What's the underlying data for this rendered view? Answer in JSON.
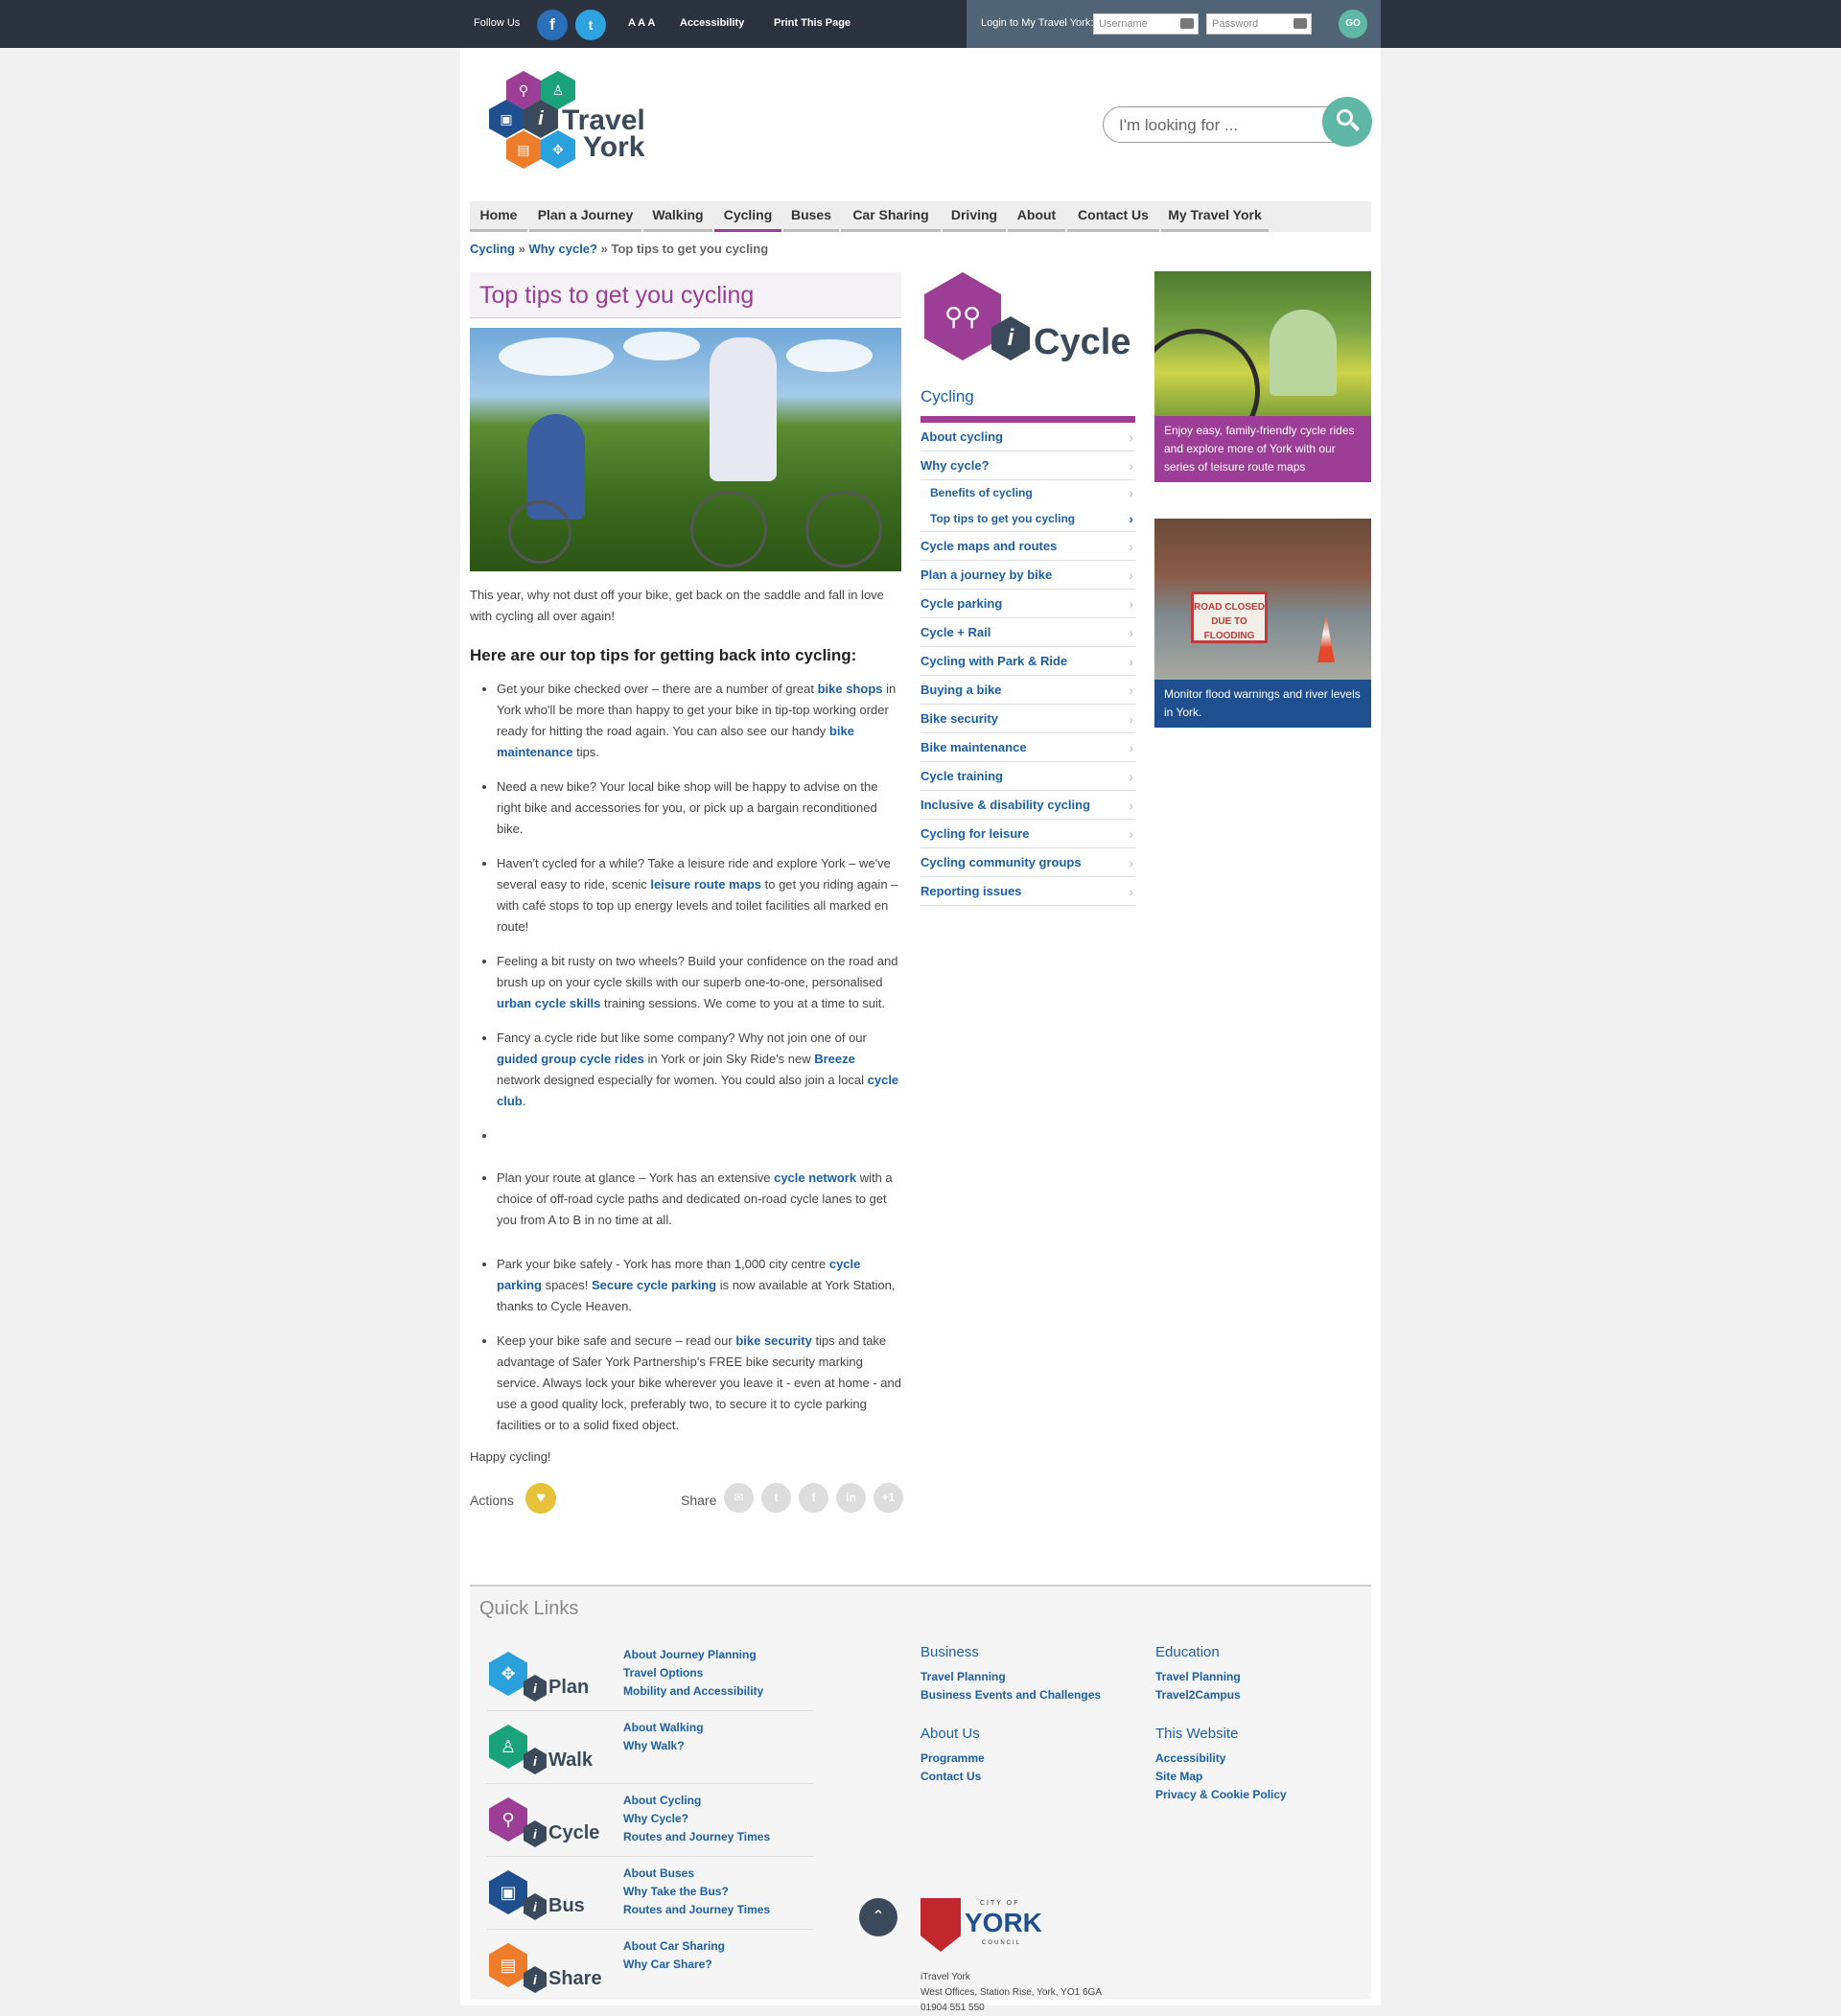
{
  "topbar": {
    "follow_label": "Follow Us",
    "facebook_glyph": "f",
    "twitter_glyph": "t",
    "text_size_label": "A A A",
    "accessibility_label": "Accessibility",
    "print_label": "Print This Page",
    "login_label": "Login to My Travel York:",
    "username_placeholder": "Username",
    "password_placeholder": "Password",
    "go_label": "GO"
  },
  "header": {
    "logo_line1": "Travel",
    "logo_line2": "York",
    "search_placeholder": "I'm looking for ..."
  },
  "nav": [
    {
      "label": "Home"
    },
    {
      "label": "Plan a Journey"
    },
    {
      "label": "Walking"
    },
    {
      "label": "Cycling"
    },
    {
      "label": "Buses"
    },
    {
      "label": "Car Sharing"
    },
    {
      "label": "Driving"
    },
    {
      "label": "About"
    },
    {
      "label": "Contact Us"
    },
    {
      "label": "My Travel York"
    }
  ],
  "breadcrumb": {
    "item1": "Cycling",
    "sep1": "»",
    "item2": "Why cycle?",
    "sep2": "»",
    "current": "Top tips to get you cycling"
  },
  "main": {
    "title": "Top tips to get you cycling",
    "intro": "This year, why not dust off your bike, get back on the saddle and fall in love with cycling all over again!",
    "subheading": "Here are our top tips for getting back into cycling:",
    "tips": [
      {
        "a": "Get your bike checked over – there are a number of great ",
        "l1": "bike shops",
        "b": " in York who'll be more than happy to get your bike in tip-top working order ready for hitting the road again. You can also see our handy ",
        "l2": "bike maintenance",
        "c": " tips."
      },
      {
        "a": "Need a new bike? Your local bike shop will be happy to advise on the right bike and accessories for you, or pick up a bargain reconditioned bike."
      },
      {
        "a": "Haven't cycled for a while? Take a leisure ride and explore York – we've several easy to ride, scenic ",
        "l1": "leisure route maps",
        "b": " to get you riding again – with café stops to top up energy levels and toilet facilities all marked en route!"
      },
      {
        "a": "Feeling a bit rusty on two wheels? Build your confidence on the road and brush up on your cycle skills with our superb one-to-one, personalised ",
        "l1": "urban cycle skills",
        "b": " training sessions. We come to you at a time to suit."
      },
      {
        "a": "Fancy a cycle ride but like some company? Why not join one of our ",
        "l1": "guided group cycle rides",
        "b": " in York or join Sky Ride's new ",
        "l2": "Breeze",
        "c": " network designed especially for women. You could also join a local ",
        "l3": "cycle club",
        "d": "."
      },
      {
        "a": "Plan your route at glance – York has an extensive ",
        "l1": "cycle network",
        "b": " with a choice of off-road cycle paths and dedicated on-road cycle lanes to get you from A to B in no time at all."
      },
      {
        "a": "Park your bike safely - York has more than 1,000 city centre ",
        "l1": "cycle parking",
        "b": " spaces! ",
        "l2": "Secure cycle parking",
        "c": " is now available at York Station, thanks to Cycle Heaven."
      },
      {
        "a": "Keep your bike safe and secure – read our ",
        "l1": "bike security",
        "b": " tips and take advantage of Safer York Partnership's FREE bike security marking service. Always lock your bike wherever you leave it - even at home - and use a good quality lock, preferably two, to secure it to cycle parking facilities or to a solid fixed object."
      }
    ],
    "outro": "Happy cycling!",
    "actions_label": "Actions",
    "share_label": "Share",
    "share_icons": [
      "email-icon",
      "twitter-icon",
      "facebook-icon",
      "linkedin-icon",
      "google-plus-icon"
    ],
    "share_glyphs": [
      "✉",
      "t",
      "f",
      "in",
      "+1"
    ]
  },
  "sidebar": {
    "brand_text": "Cycle",
    "title": "Cycling",
    "items": [
      {
        "label": "About cycling"
      },
      {
        "label": "Why cycle?"
      },
      {
        "label": "Benefits of cycling"
      },
      {
        "label": "Top tips to get you cycling"
      },
      {
        "label": "Cycle maps and routes"
      },
      {
        "label": "Plan a journey by bike"
      },
      {
        "label": "Cycle parking"
      },
      {
        "label": "Cycle + Rail"
      },
      {
        "label": "Cycling with Park & Ride"
      },
      {
        "label": "Buying a bike"
      },
      {
        "label": "Bike security"
      },
      {
        "label": "Bike maintenance"
      },
      {
        "label": "Cycle training"
      },
      {
        "label": "Inclusive & disability cycling"
      },
      {
        "label": "Cycling for leisure"
      },
      {
        "label": "Cycling community groups"
      },
      {
        "label": "Reporting issues"
      }
    ]
  },
  "promos": [
    {
      "caption": "Enjoy easy, family-friendly cycle rides and explore more of York with our series of leisure route maps",
      "color": "#9c3d96"
    },
    {
      "caption": "Monitor flood warnings and river levels in York.",
      "color": "#1f4f8f",
      "sign": "ROAD CLOSED DUE TO FLOODING"
    }
  ],
  "footer": {
    "quick_links_title": "Quick Links",
    "quick_rows": [
      {
        "brand": "Plan",
        "color": "#2aa0dc",
        "links": [
          "About Journey Planning",
          "Travel Options",
          "Mobility and Accessibility"
        ]
      },
      {
        "brand": "Walk",
        "color": "#1aa37a",
        "links": [
          "About Walking",
          "Why Walk?"
        ]
      },
      {
        "brand": "Cycle",
        "color": "#9c3d96",
        "links": [
          "About Cycling",
          "Why Cycle?",
          "Routes and Journey Times"
        ]
      },
      {
        "brand": "Bus",
        "color": "#1f4f8f",
        "links": [
          "About Buses",
          "Why Take the Bus?",
          "Routes and Journey Times"
        ]
      },
      {
        "brand": "Share",
        "color": "#ee7d2b",
        "links": [
          "About Car Sharing",
          "Why Car Share?"
        ]
      }
    ],
    "columns": [
      {
        "heading": "Business",
        "links": [
          "Travel Planning",
          "Business Events and Challenges"
        ]
      },
      {
        "heading": "Education",
        "links": [
          "Travel Planning",
          "Travel2Campus"
        ]
      },
      {
        "heading": "About Us",
        "links": [
          "Programme",
          "Contact Us"
        ]
      },
      {
        "heading": "This Website",
        "links": [
          "Accessibility",
          "Site Map",
          "Privacy & Cookie Policy"
        ]
      }
    ],
    "council_small": "CITY OF",
    "council_name": "YORK",
    "council_sub": "COUNCIL",
    "address": [
      "iTravel York",
      "West Offices, Station Rise, York, YO1 6GA",
      "01904 551 550"
    ]
  }
}
